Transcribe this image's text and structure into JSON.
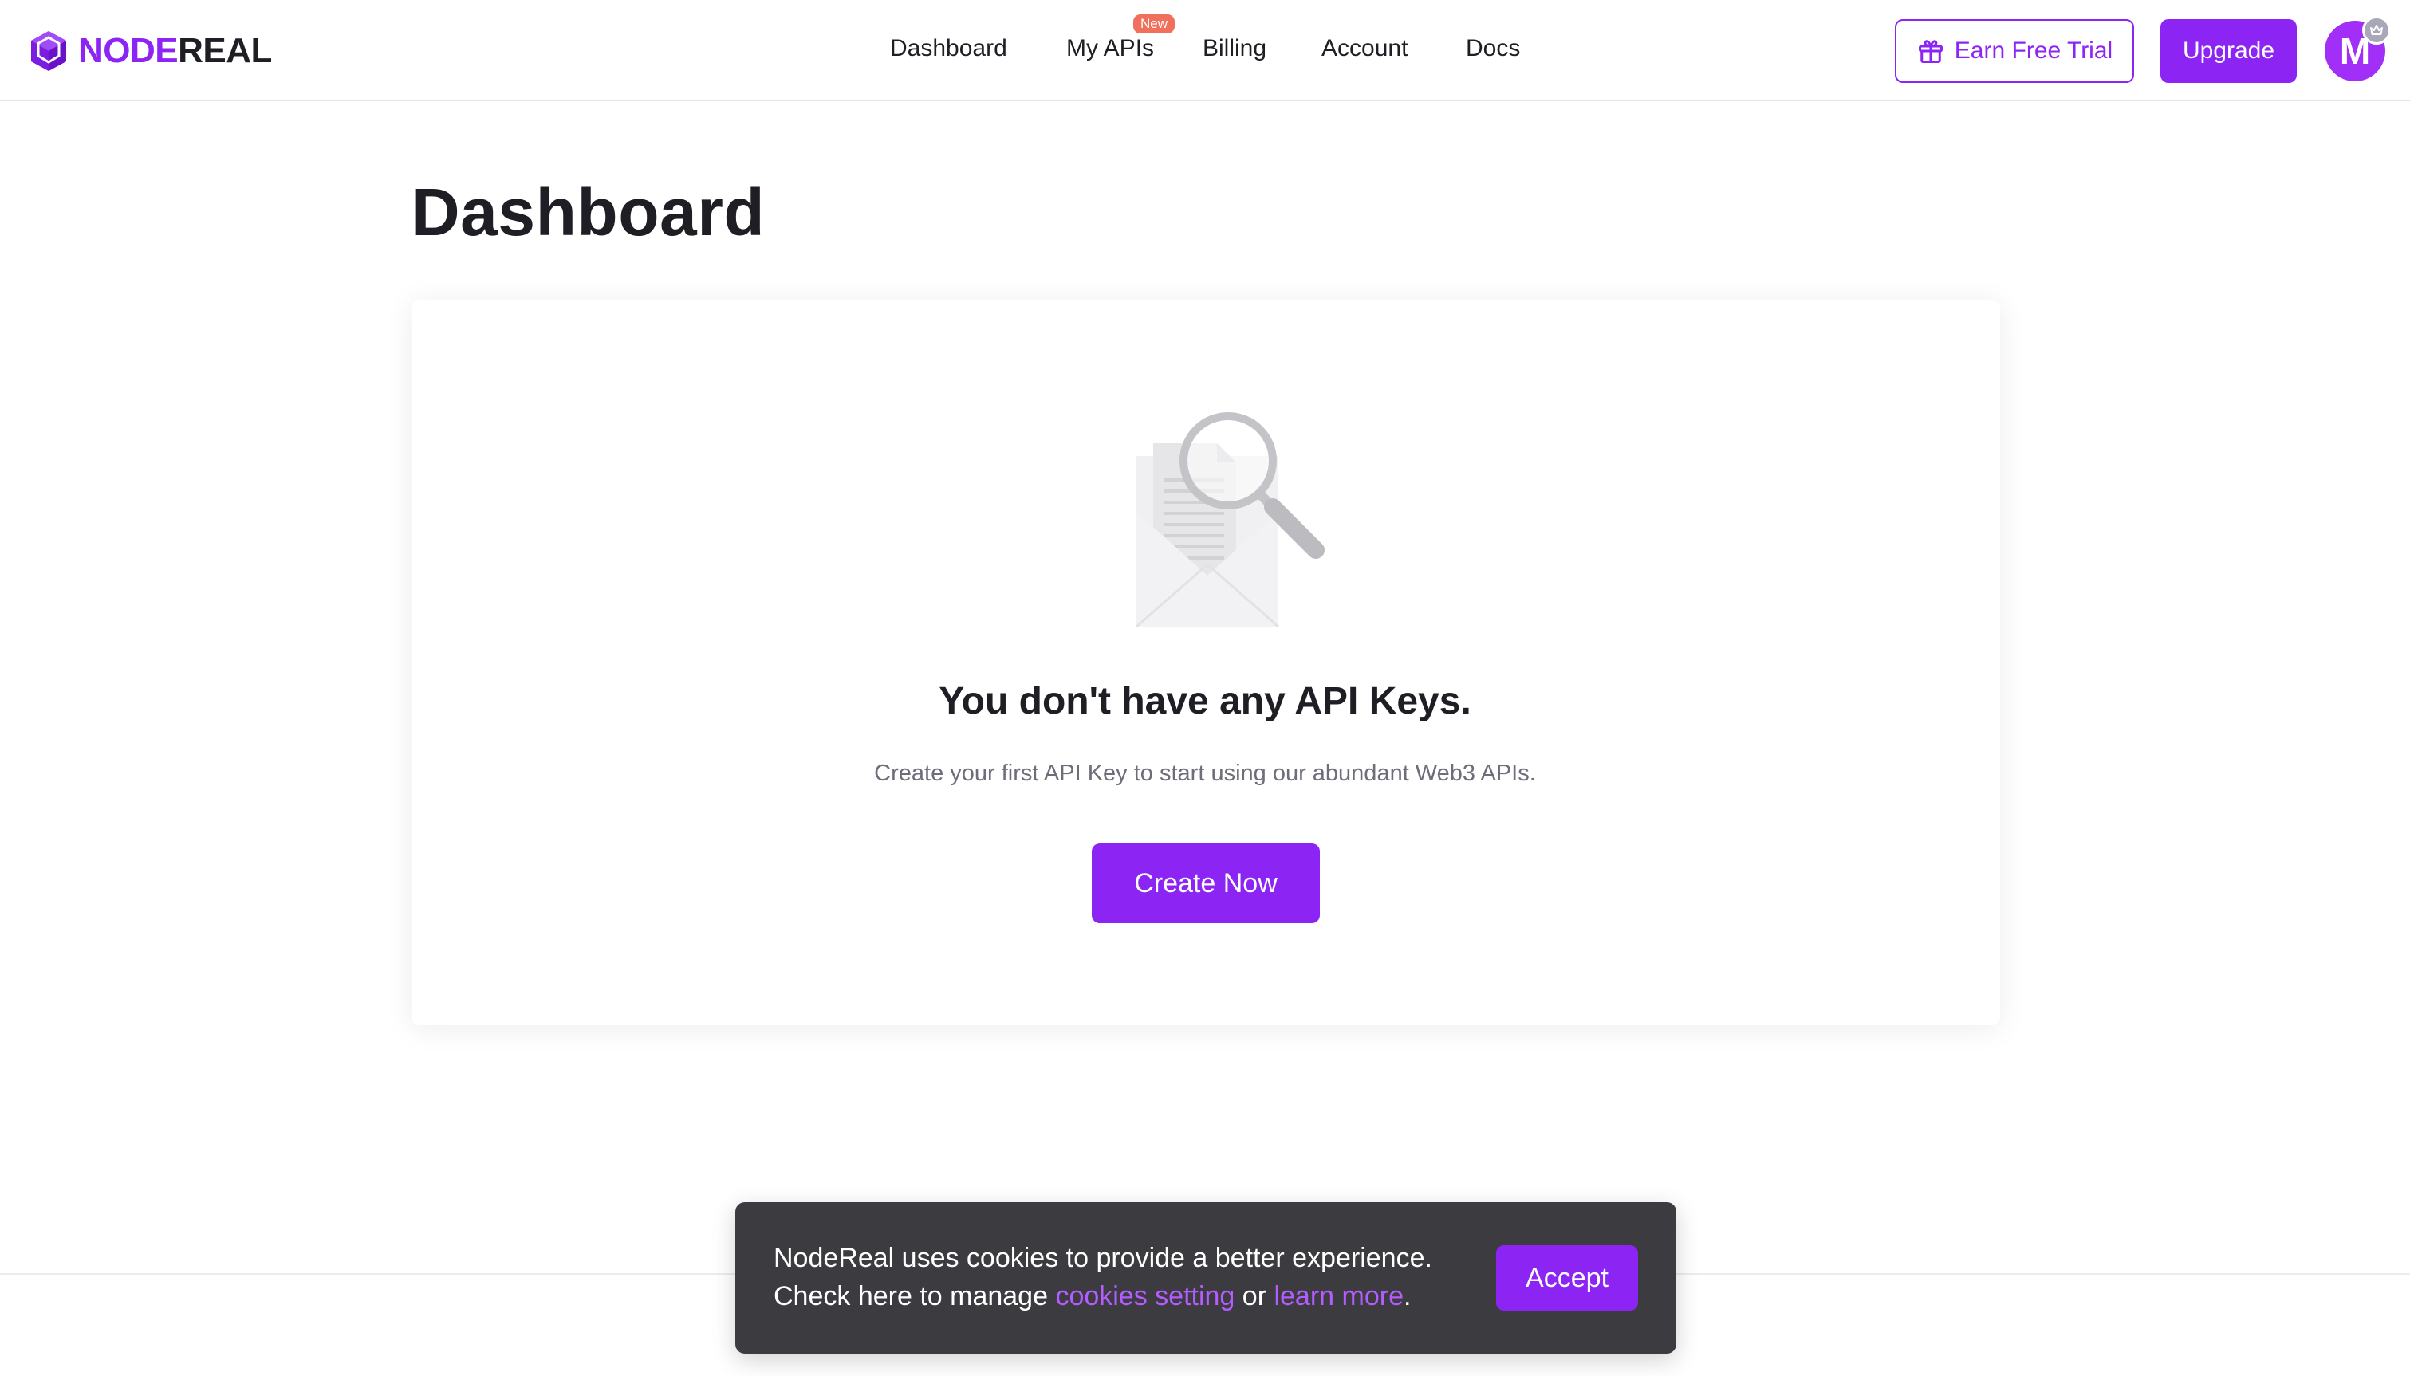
{
  "brand": {
    "logo_part1": "NODE",
    "logo_part2": "REAL",
    "accent_color": "#8c25f4"
  },
  "nav": {
    "items": [
      {
        "label": "Dashboard"
      },
      {
        "label": "My APIs",
        "badge": "New"
      },
      {
        "label": "Billing"
      },
      {
        "label": "Account"
      },
      {
        "label": "Docs"
      }
    ]
  },
  "header_actions": {
    "earn_trial_label": "Earn Free Trial",
    "earn_trial_icon": "gift-icon",
    "upgrade_label": "Upgrade",
    "avatar_initial": "M",
    "avatar_badge_icon": "crown-icon"
  },
  "main": {
    "title": "Dashboard",
    "empty_state": {
      "illustration": "empty-envelope-search-icon",
      "heading": "You don't have any API Keys.",
      "description": "Create your first API Key to start using our abundant Web3 APIs.",
      "cta_label": "Create Now"
    }
  },
  "cookie_banner": {
    "line1": "NodeReal uses cookies to provide a better experience.",
    "line2_prefix": "Check here to manage ",
    "link1": "cookies setting",
    "middle": " or ",
    "link2": "learn more",
    "suffix": ".",
    "accept_label": "Accept"
  }
}
